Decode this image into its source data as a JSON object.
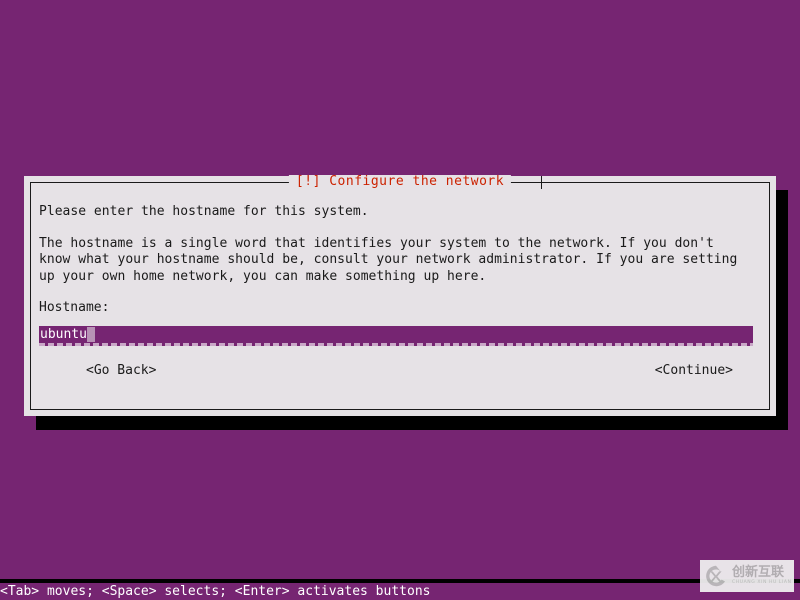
{
  "screen": {
    "background_color": "#762572",
    "text_color": "#ffffff"
  },
  "dialog": {
    "title": "[!] Configure the network",
    "title_color": "#cc2200",
    "background_color": "#e6e2e6",
    "border_color": "#1a1a1a",
    "paragraphs": {
      "intro": "Please enter the hostname for this system.",
      "body": "The hostname is a single word that identifies your system to the network. If you don't\nknow what your hostname should be, consult your network administrator. If you are setting\nup your own home network, you can make something up here."
    },
    "field": {
      "label": "Hostname:",
      "value": "ubuntu",
      "placeholder": "ubuntu",
      "field_background_color": "#762572",
      "field_text_color": "#ffffff"
    },
    "buttons": {
      "go_back": "<Go Back>",
      "continue": "<Continue>"
    }
  },
  "statusbar": {
    "help_text": "<Tab> moves; <Space> selects; <Enter> activates buttons"
  },
  "watermark": {
    "chinese": "创新互联",
    "pinyin": "CHUANG XIN HU LIAN",
    "mark_icon": "cx-logo-icon"
  }
}
